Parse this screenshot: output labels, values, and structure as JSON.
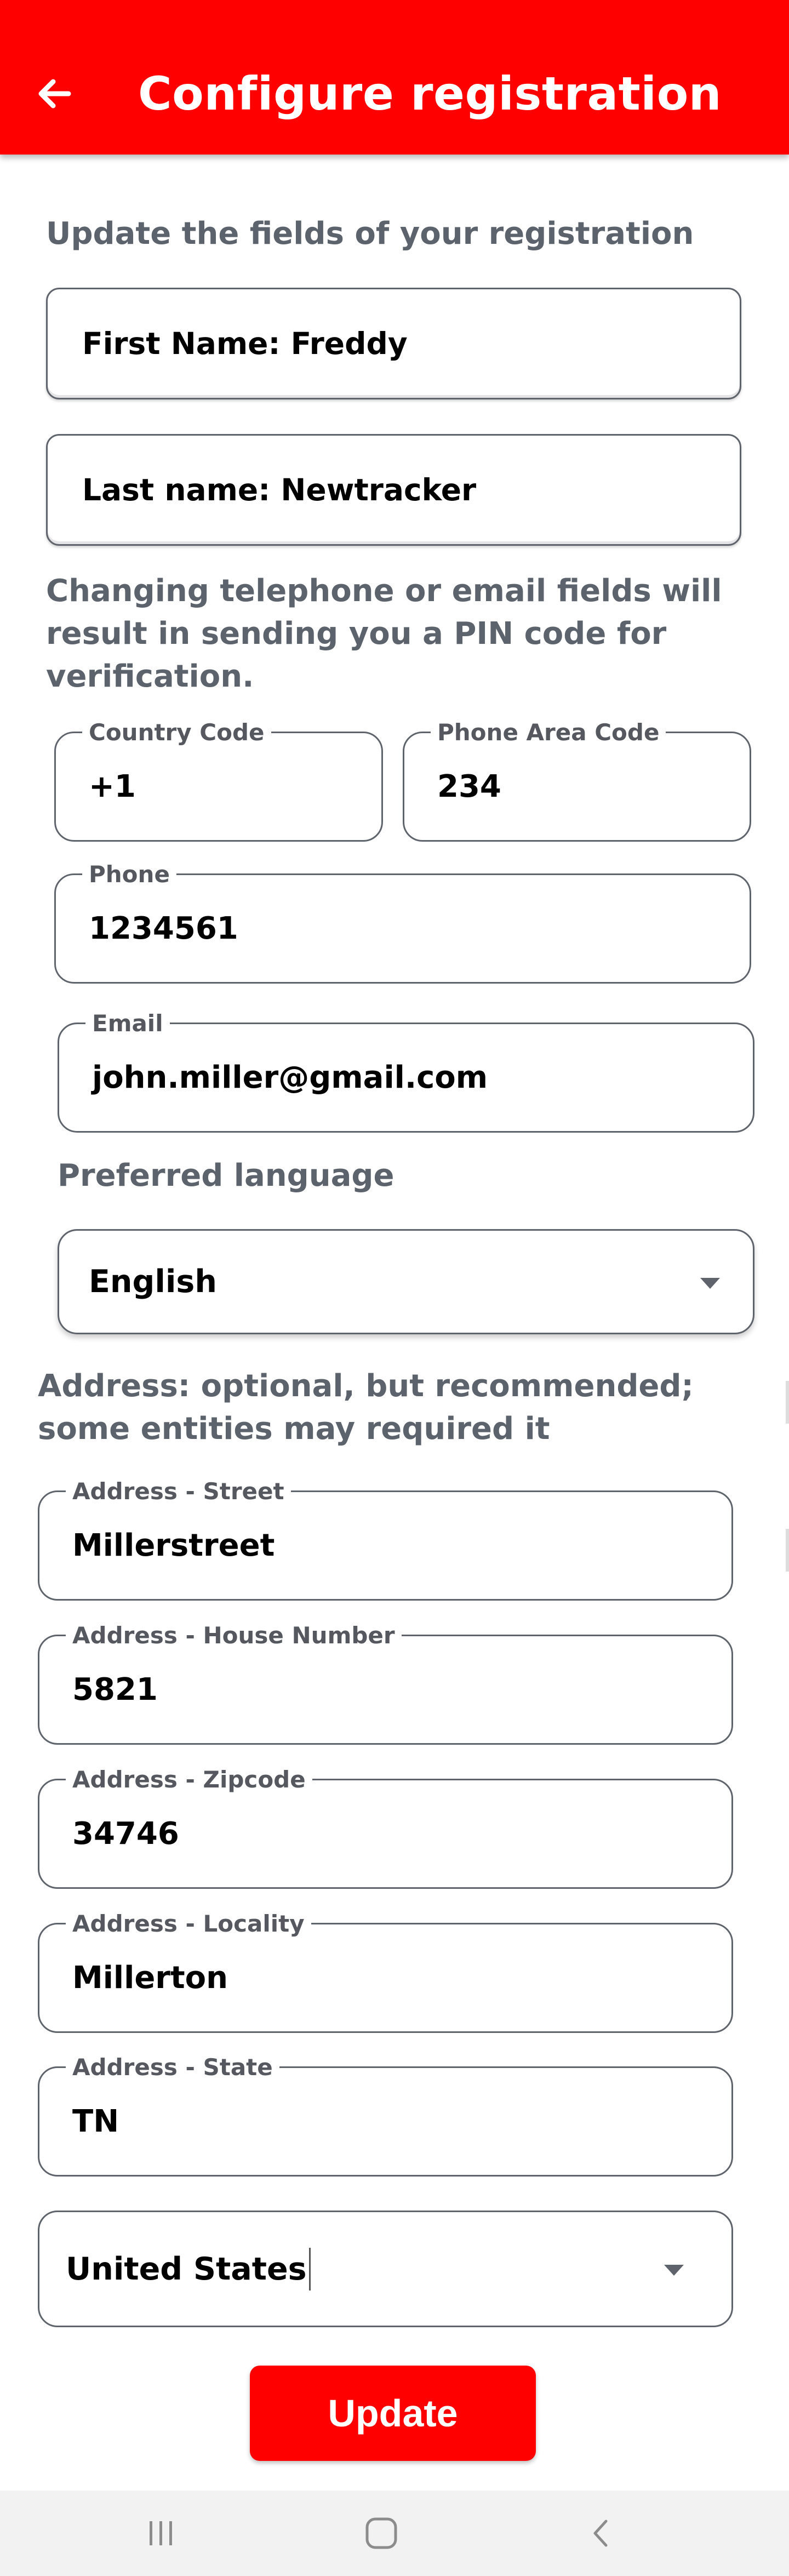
{
  "app_bar": {
    "title": "Configure registration",
    "back_icon": "arrow-left-icon",
    "color": "#ff0000"
  },
  "intro_text": "Update the fields of your registration",
  "first_name_field": {
    "value": "First Name: Freddy"
  },
  "last_name_field": {
    "value": "Last name: Newtracker"
  },
  "verification_note": "Changing telephone or email fields will result in sending you a PIN code for verification.",
  "country_code": {
    "label": "Country Code",
    "value": "+1"
  },
  "phone_area_code": {
    "label": "Phone Area Code",
    "value": "234"
  },
  "phone": {
    "label": "Phone",
    "value": "1234561"
  },
  "email": {
    "label": "Email",
    "value": "john.miller@gmail.com"
  },
  "preferred_language": {
    "label": "Preferred language",
    "selected": "English"
  },
  "address_note": "Address: optional, but recommended; some entities may required it",
  "address_street": {
    "label": "Address - Street",
    "value": "Millerstreet"
  },
  "address_house_number": {
    "label": "Address - House Number",
    "value": "5821"
  },
  "address_zipcode": {
    "label": "Address - Zipcode",
    "value": "34746"
  },
  "address_locality": {
    "label": "Address - Locality",
    "value": "Millerton"
  },
  "address_state": {
    "label": "Address - State",
    "value": "TN"
  },
  "country": {
    "selected": "United States"
  },
  "update_button": {
    "label": "Update"
  },
  "system_nav": {
    "recents_icon": "recents-icon",
    "home_icon": "home-icon",
    "back_icon": "chevron-left-icon"
  }
}
